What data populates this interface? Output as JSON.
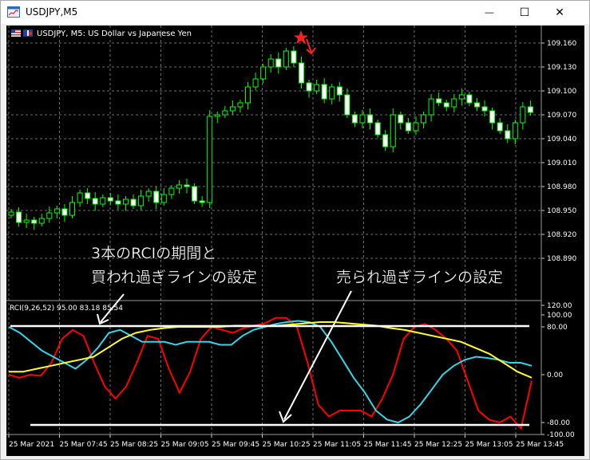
{
  "window": {
    "title": "USDJPY,M5",
    "minimize_glyph": "—",
    "maximize_glyph": "☐",
    "close_glyph": "✕"
  },
  "chart": {
    "symbol_label": "USDJPY, M5:  US Dollar vs Japanese Yen",
    "indicator_label": "RCI(9,26,52) 95.00 83.18 85.54",
    "annotation_left_line1": "3本のRCIの期間と",
    "annotation_left_line2": "買われ過ぎラインの設定",
    "annotation_right": "売られ過ぎラインの設定",
    "price_ticks": [
      "109.160",
      "109.130",
      "109.100",
      "109.070",
      "109.040",
      "109.010",
      "108.980",
      "108.950",
      "108.920",
      "108.890"
    ],
    "rci_ticks": [
      "120.00",
      "100.00",
      "80.00",
      "0.00",
      "-80.00",
      "-100.00"
    ],
    "time_ticks": [
      "25 Mar 2021",
      "25 Mar 07:45",
      "25 Mar 08:25",
      "25 Mar 09:05",
      "25 Mar 09:45",
      "25 Mar 10:25",
      "25 Mar 11:05",
      "25 Mar 11:45",
      "25 Mar 12:25",
      "25 Mar 13:05",
      "25 Mar 13:45"
    ],
    "colors": {
      "background": "#000000",
      "grid": "#6e6e6e",
      "candles": "#00ff00",
      "rci_short": "#ff0000",
      "rci_mid": "#33d6e6",
      "rci_long": "#ffff33",
      "levels": "#ffffff",
      "marker": "#ff2020"
    }
  },
  "chart_data": [
    {
      "type": "candlestick",
      "title": "USDJPY, M5:  US Dollar vs Japanese Yen",
      "ylim": [
        108.875,
        109.178
      ],
      "close_approx": [
        108.948,
        108.935,
        108.938,
        108.934,
        108.94,
        108.947,
        108.952,
        108.944,
        108.96,
        108.972,
        108.965,
        108.958,
        108.966,
        108.962,
        108.958,
        108.964,
        108.956,
        108.968,
        108.974,
        108.96,
        108.97,
        108.978,
        108.982,
        108.98,
        108.962,
        108.96,
        109.068,
        109.07,
        109.075,
        109.08,
        109.085,
        109.105,
        109.115,
        109.13,
        109.14,
        109.13,
        109.15,
        109.135,
        109.11,
        109.1,
        109.108,
        109.09,
        109.105,
        109.095,
        109.07,
        109.06,
        109.07,
        109.06,
        109.045,
        109.03,
        109.07,
        109.06,
        109.05,
        109.06,
        109.07,
        109.09,
        109.085,
        109.08,
        109.09,
        109.095,
        109.085,
        109.08,
        109.075,
        109.06,
        109.05,
        109.04,
        109.06,
        109.08,
        109.073
      ]
    },
    {
      "type": "line",
      "title": "RCI(9,26,52) 95.00 83.18 85.54",
      "ylim": [
        -100,
        100
      ],
      "levels": [
        80,
        -80
      ],
      "series": [
        {
          "color": "#ff0000",
          "values": [
            0,
            -5,
            0,
            -2,
            20,
            60,
            75,
            65,
            20,
            -20,
            -40,
            -20,
            20,
            65,
            60,
            10,
            -30,
            5,
            60,
            80,
            75,
            70,
            78,
            82,
            86,
            95,
            95,
            80,
            20,
            -50,
            -70,
            -60,
            -60,
            -60,
            -70,
            -40,
            0,
            60,
            80,
            85,
            75,
            60,
            40,
            -10,
            -60,
            -75,
            -80,
            -70,
            -90,
            -10
          ]
        },
        {
          "color": "#33d6e6",
          "values": [
            80,
            70,
            55,
            40,
            30,
            20,
            10,
            25,
            45,
            70,
            75,
            65,
            55,
            55,
            55,
            50,
            55,
            55,
            55,
            50,
            50,
            65,
            75,
            80,
            85,
            88,
            90,
            88,
            80,
            55,
            25,
            -5,
            -30,
            -60,
            -75,
            -80,
            -70,
            -50,
            -25,
            0,
            15,
            25,
            30,
            28,
            25,
            20,
            20,
            15
          ]
        },
        {
          "color": "#ffff33",
          "values": [
            5,
            5,
            10,
            15,
            20,
            25,
            30,
            45,
            60,
            70,
            75,
            78,
            80,
            80,
            80,
            80,
            82,
            82,
            82,
            82,
            84,
            86,
            88,
            88,
            86,
            84,
            82,
            78,
            75,
            70,
            65,
            60,
            55,
            45,
            35,
            20,
            5,
            -5
          ]
        }
      ]
    }
  ]
}
